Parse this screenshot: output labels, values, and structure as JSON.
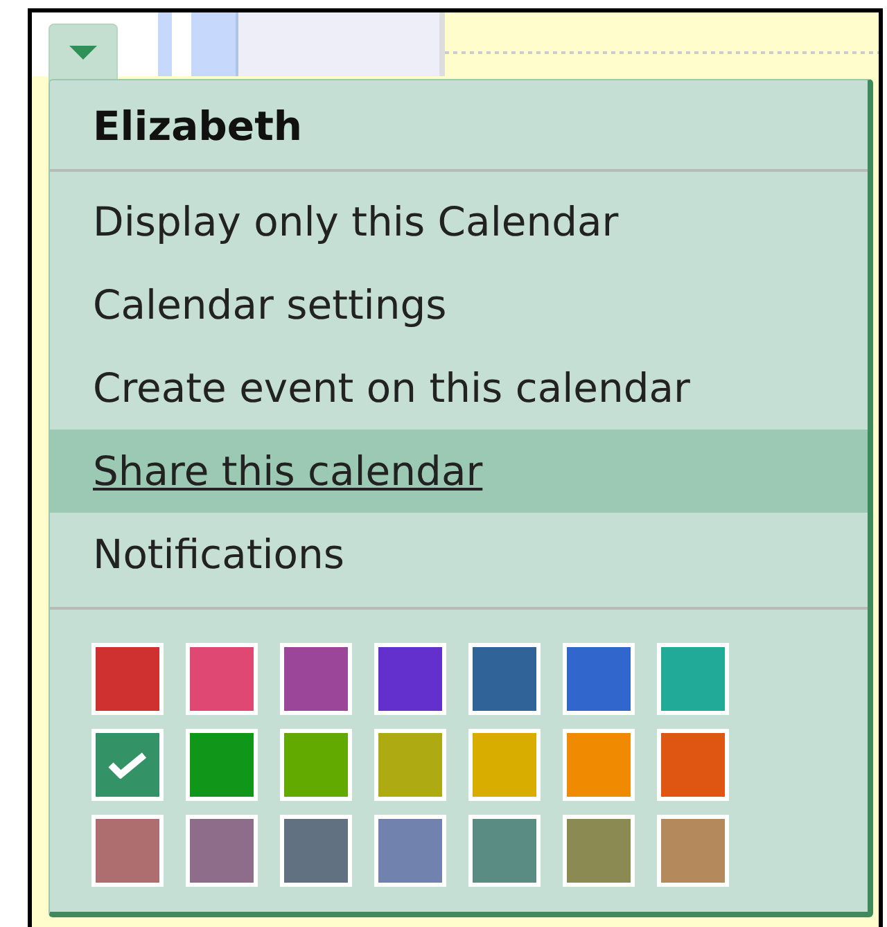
{
  "menu_button": {
    "expanded": true
  },
  "menu": {
    "title": "Elizabeth",
    "items": [
      {
        "label": "Display only this Calendar",
        "selected": false
      },
      {
        "label": "Calendar settings",
        "selected": false
      },
      {
        "label": "Create event on this calendar",
        "selected": false
      },
      {
        "label": "Share this calendar",
        "selected": true
      },
      {
        "label": "Notifications",
        "selected": false
      }
    ],
    "swatches": [
      {
        "color": "#cf3131",
        "selected": false
      },
      {
        "color": "#df4872",
        "selected": false
      },
      {
        "color": "#9b4698",
        "selected": false
      },
      {
        "color": "#6330cd",
        "selected": false
      },
      {
        "color": "#306398",
        "selected": false
      },
      {
        "color": "#3166cd",
        "selected": false
      },
      {
        "color": "#22aa99",
        "selected": false
      },
      {
        "color": "#339366",
        "selected": true
      },
      {
        "color": "#109618",
        "selected": false
      },
      {
        "color": "#63aa00",
        "selected": false
      },
      {
        "color": "#aeaa12",
        "selected": false
      },
      {
        "color": "#d8ad00",
        "selected": false
      },
      {
        "color": "#f08a00",
        "selected": false
      },
      {
        "color": "#de5612",
        "selected": false
      },
      {
        "color": "#ae6e70",
        "selected": false
      },
      {
        "color": "#8e6d8b",
        "selected": false
      },
      {
        "color": "#617181",
        "selected": false
      },
      {
        "color": "#7282ae",
        "selected": false
      },
      {
        "color": "#5a8c83",
        "selected": false
      },
      {
        "color": "#8b8a52",
        "selected": false
      },
      {
        "color": "#b48a5c",
        "selected": false
      }
    ]
  }
}
